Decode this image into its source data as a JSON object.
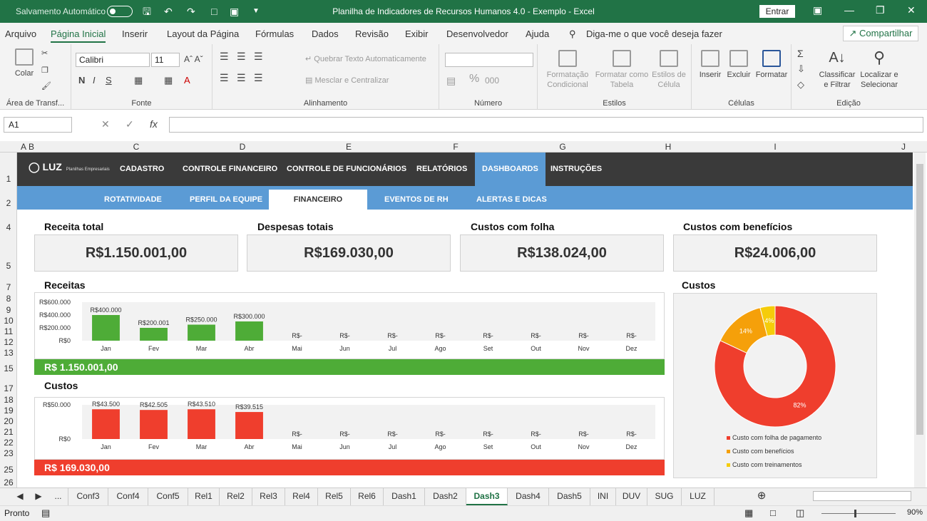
{
  "titlebar": {
    "autosave": "Salvamento Automático",
    "title": "Planilha de Indicadores de Recursos Humanos 4.0 - Exemplo  -  Excel",
    "signin": "Entrar"
  },
  "menu": {
    "items": [
      "Arquivo",
      "Página Inicial",
      "Inserir",
      "Layout da Página",
      "Fórmulas",
      "Dados",
      "Revisão",
      "Exibir",
      "Desenvolvedor",
      "Ajuda"
    ],
    "search": "Diga-me o que você deseja fazer",
    "share": "Compartilhar"
  },
  "ribbon": {
    "paste": "Colar",
    "clipboard": "Área de Transf...",
    "font_name": "Calibri",
    "font_size": "11",
    "font_group": "Fonte",
    "wrap": "Quebrar Texto Automaticamente",
    "merge": "Mesclar e Centralizar",
    "align_group": "Alinhamento",
    "number_group": "Número",
    "cond_format": "Formatação Condicional",
    "format_table": "Formatar como Tabela",
    "cell_styles": "Estilos de Célula",
    "styles_group": "Estilos",
    "insert": "Inserir",
    "delete": "Excluir",
    "format": "Formatar",
    "cells_group": "Células",
    "sort": "Classificar e Filtrar",
    "find": "Localizar e Selecionar",
    "edit_group": "Edição"
  },
  "formula_bar": {
    "name_box": "A1",
    "fx": "fx"
  },
  "columns": [
    {
      "label": "A"
    },
    {
      "label": "B"
    },
    {
      "label": "C"
    },
    {
      "label": "D"
    },
    {
      "label": "E"
    },
    {
      "label": "F"
    },
    {
      "label": "G"
    },
    {
      "label": "H"
    },
    {
      "label": "I"
    },
    {
      "label": "J"
    }
  ],
  "rows": [
    "1",
    "2",
    "4",
    "5",
    "7",
    "8",
    "9",
    "10",
    "11",
    "12",
    "13",
    "15",
    "17",
    "18",
    "19",
    "20",
    "21",
    "22",
    "23",
    "25",
    "26"
  ],
  "nav": {
    "logo": "LUZ",
    "logo_sub": "Planilhas Empresariais",
    "main": [
      "CADASTRO",
      "CONTROLE FINANCEIRO",
      "CONTROLE DE FUNCIONÁRIOS",
      "RELATÓRIOS",
      "DASHBOARDS",
      "INSTRUÇÕES"
    ],
    "sub": [
      "ROTATIVIDADE",
      "PERFIL DA EQUIPE",
      "FINANCEIRO",
      "EVENTOS DE RH",
      "ALERTAS E DICAS"
    ]
  },
  "kpis": [
    {
      "title": "Receita total",
      "value": "R$1.150.001,00"
    },
    {
      "title": "Despesas totais",
      "value": "R$169.030,00"
    },
    {
      "title": "Custos com folha",
      "value": "R$138.024,00"
    },
    {
      "title": "Custos com benefícios",
      "value": "R$24.006,00"
    }
  ],
  "chart_data": [
    {
      "type": "bar",
      "title": "Receitas",
      "categories": [
        "Jan",
        "Fev",
        "Mar",
        "Abr",
        "Mai",
        "Jun",
        "Jul",
        "Ago",
        "Set",
        "Out",
        "Nov",
        "Dez"
      ],
      "values": [
        400000,
        200001,
        250000,
        300000,
        0,
        0,
        0,
        0,
        0,
        0,
        0,
        0
      ],
      "data_labels": [
        "R$400.000",
        "R$200.001",
        "R$250.000",
        "R$300.000",
        "R$-",
        "R$-",
        "R$-",
        "R$-",
        "R$-",
        "R$-",
        "R$-",
        "R$-"
      ],
      "yticks": [
        "R$600.000",
        "R$400.000",
        "R$200.000",
        "R$0"
      ],
      "ylim": [
        0,
        600000
      ],
      "color": "#4eac37",
      "total": "R$ 1.150.001,00"
    },
    {
      "type": "bar",
      "title": "Custos",
      "categories": [
        "Jan",
        "Fev",
        "Mar",
        "Abr",
        "Mai",
        "Jun",
        "Jul",
        "Ago",
        "Set",
        "Out",
        "Nov",
        "Dez"
      ],
      "values": [
        43500,
        42505,
        43510,
        39515,
        0,
        0,
        0,
        0,
        0,
        0,
        0,
        0
      ],
      "data_labels": [
        "R$43.500",
        "R$42.505",
        "R$43.510",
        "R$39.515",
        "R$-",
        "R$-",
        "R$-",
        "R$-",
        "R$-",
        "R$-",
        "R$-",
        "R$-"
      ],
      "yticks": [
        "R$50.000",
        "R$0"
      ],
      "ylim": [
        0,
        50000
      ],
      "color": "#ef3e2d",
      "total": "R$ 169.030,00"
    },
    {
      "type": "pie",
      "title": "Custos",
      "slices": [
        {
          "name": "Custo com folha de pagamento",
          "value": 82,
          "label": "82%",
          "color": "#ef3e2d"
        },
        {
          "name": "Custo com benefícios",
          "value": 14,
          "label": "14%",
          "color": "#f5a00a"
        },
        {
          "name": "Custo com treinamentos",
          "value": 4,
          "label": "4%",
          "color": "#f5cc0a"
        }
      ]
    }
  ],
  "tabs": [
    "...",
    "Conf3",
    "Conf4",
    "Conf5",
    "Rel1",
    "Rel2",
    "Rel3",
    "Rel4",
    "Rel5",
    "Rel6",
    "Dash1",
    "Dash2",
    "Dash3",
    "Dash4",
    "Dash5",
    "INI",
    "DUV",
    "SUG",
    "LUZ"
  ],
  "active_tab": "Dash3",
  "status": {
    "ready": "Pronto",
    "zoom": "90%"
  }
}
